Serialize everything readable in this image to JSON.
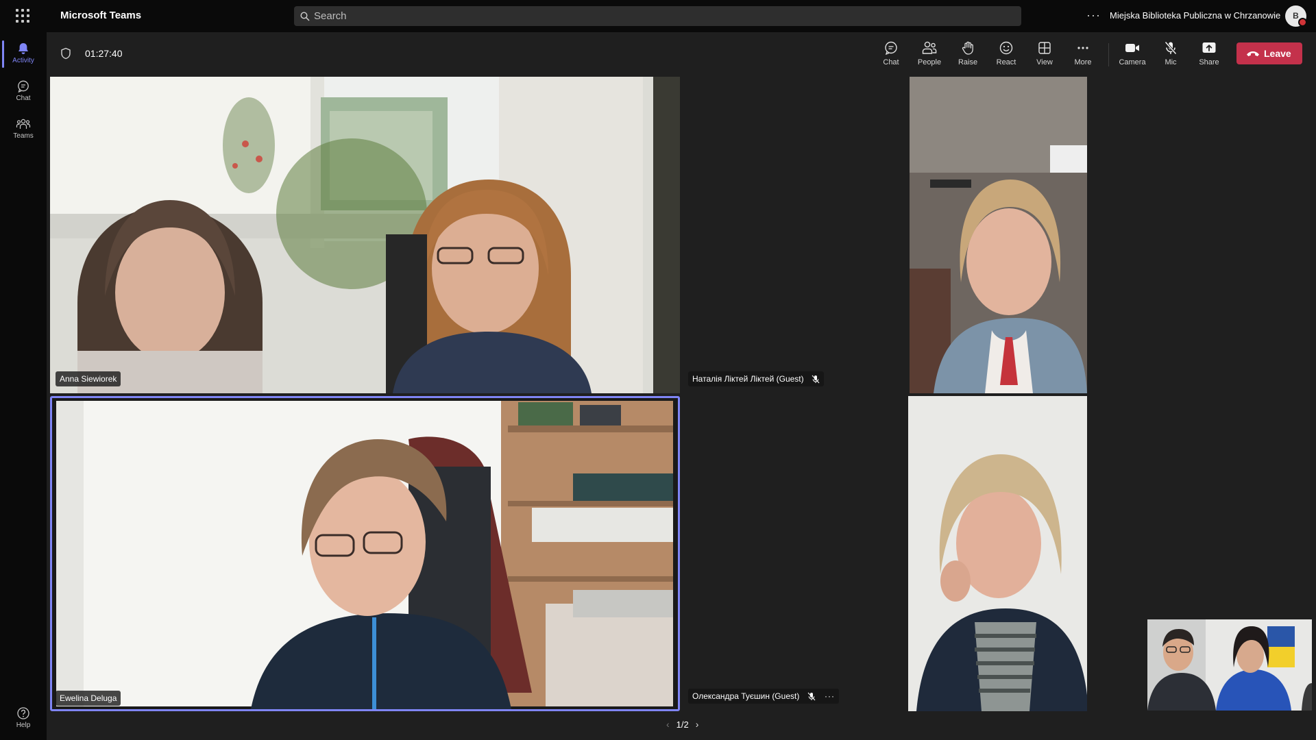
{
  "app": {
    "title": "Microsoft Teams"
  },
  "search": {
    "placeholder": "Search"
  },
  "account": {
    "org_name": "Miejska Biblioteka Publiczna w Chrzanowie",
    "avatar_initial": "B"
  },
  "rail": {
    "items": [
      {
        "label": "Activity",
        "icon": "bell-icon",
        "active": true
      },
      {
        "label": "Chat",
        "icon": "chat-icon",
        "active": false
      },
      {
        "label": "Teams",
        "icon": "teams-icon",
        "active": false
      }
    ],
    "help_label": "Help"
  },
  "call": {
    "elapsed": "01:27:40",
    "controls": [
      {
        "label": "Chat",
        "icon": "chat-bubble-icon"
      },
      {
        "label": "People",
        "icon": "people-icon"
      },
      {
        "label": "Raise",
        "icon": "raise-hand-icon"
      },
      {
        "label": "React",
        "icon": "smile-icon"
      },
      {
        "label": "View",
        "icon": "grid-view-icon"
      },
      {
        "label": "More",
        "icon": "more-dots-icon"
      },
      {
        "label": "Camera",
        "icon": "camera-icon"
      },
      {
        "label": "Mic",
        "icon": "mic-off-icon"
      },
      {
        "label": "Share",
        "icon": "share-tray-icon"
      }
    ],
    "leave_label": "Leave"
  },
  "participants": [
    {
      "name": "Anna Siewiorek",
      "muted": false
    },
    {
      "name": "Ewelina Deluga",
      "muted": false,
      "speaking": true
    },
    {
      "name": "Наталія Ліктей Ліктей (Guest)",
      "muted": true
    },
    {
      "name": "Олександра Туєшин (Guest)",
      "muted": true
    }
  ],
  "pagination": {
    "label": "1/2"
  },
  "colors": {
    "accent": "#7f85f5",
    "leave": "#c4314b",
    "background": "#1f1f1f",
    "chrome": "#0a0a0a"
  }
}
